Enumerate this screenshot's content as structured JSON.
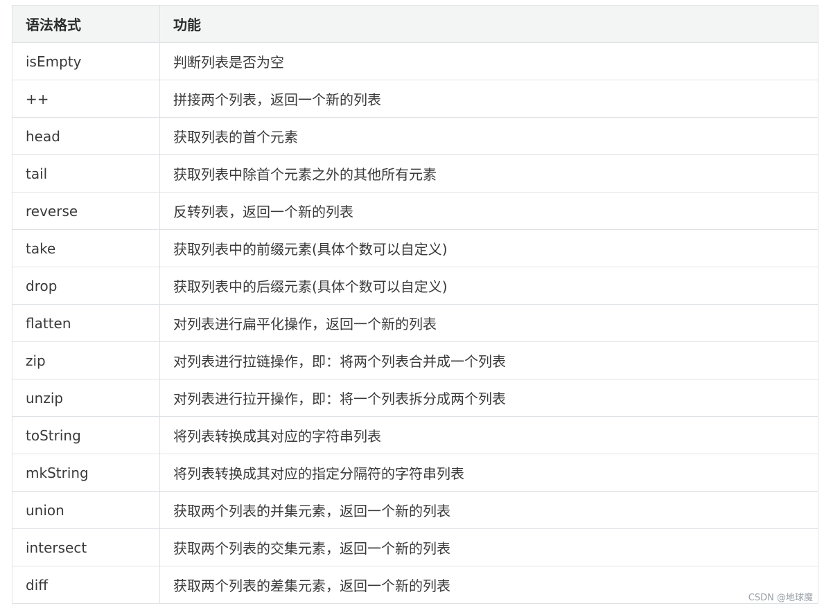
{
  "table": {
    "headers": [
      "语法格式",
      "功能"
    ],
    "rows": [
      [
        "isEmpty",
        "判断列表是否为空"
      ],
      [
        "++",
        "拼接两个列表，返回一个新的列表"
      ],
      [
        "head",
        "获取列表的首个元素"
      ],
      [
        "tail",
        "获取列表中除首个元素之外的其他所有元素"
      ],
      [
        "reverse",
        "反转列表，返回一个新的列表"
      ],
      [
        "take",
        "获取列表中的前缀元素(具体个数可以自定义)"
      ],
      [
        "drop",
        "获取列表中的后缀元素(具体个数可以自定义)"
      ],
      [
        "flatten",
        "对列表进行扁平化操作，返回一个新的列表"
      ],
      [
        "zip",
        "对列表进行拉链操作，即：将两个列表合并成一个列表"
      ],
      [
        "unzip",
        "对列表进行拉开操作，即：将一个列表拆分成两个列表"
      ],
      [
        "toString",
        "将列表转换成其对应的字符串列表"
      ],
      [
        "mkString",
        "将列表转换成其对应的指定分隔符的字符串列表"
      ],
      [
        "union",
        "获取两个列表的并集元素，返回一个新的列表"
      ],
      [
        "intersect",
        "获取两个列表的交集元素，返回一个新的列表"
      ],
      [
        "diff",
        "获取两个列表的差集元素，返回一个新的列表"
      ]
    ]
  },
  "watermark": "CSDN @地球魔",
  "colors": {
    "header_bg": "#f3f4f4",
    "border": "#dfe2e5",
    "text": "#3a3a3a"
  }
}
